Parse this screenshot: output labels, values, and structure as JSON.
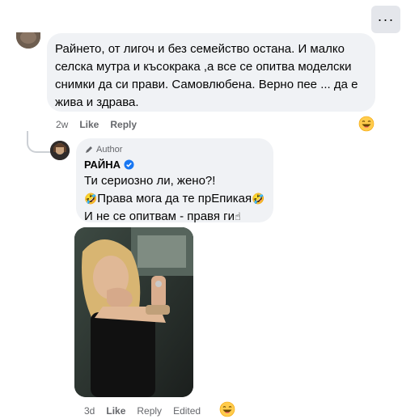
{
  "more_button": {
    "icon": "ellipsis-icon",
    "label": "···"
  },
  "comment1": {
    "text": "Райнето, от лигоч и без семейство остана. И малко селска мутра и късокрака ,а все се опитва моделски снимки да си прави. Самовлюбена. Верно пее ... да е жива и здрава.",
    "time": "2w",
    "like_label": "Like",
    "reply_label": "Reply",
    "reaction_icon": "laughing-emoji-icon"
  },
  "reply": {
    "author_badge": "Author",
    "author_name": "РАЙНА",
    "verified_icon": "verified-badge-icon",
    "lines": [
      {
        "pre": "",
        "text": "Ти сериозно ли, жено?!",
        "post": ""
      },
      {
        "pre": "🤣",
        "text": "Права мога да те прЕпикая",
        "post": "🤣"
      },
      {
        "pre": "",
        "text": "И не се опитвам - правя ги",
        "post": "☝"
      }
    ],
    "time": "3d",
    "like_label": "Like",
    "reply_label": "Reply",
    "edited_label": "Edited",
    "reaction_icon": "laughing-emoji-icon"
  },
  "colors": {
    "bubble_bg": "#f0f2f5",
    "meta_text": "#65676b",
    "verified_blue": "#1877f2",
    "thread_line": "#ccd0d5"
  }
}
